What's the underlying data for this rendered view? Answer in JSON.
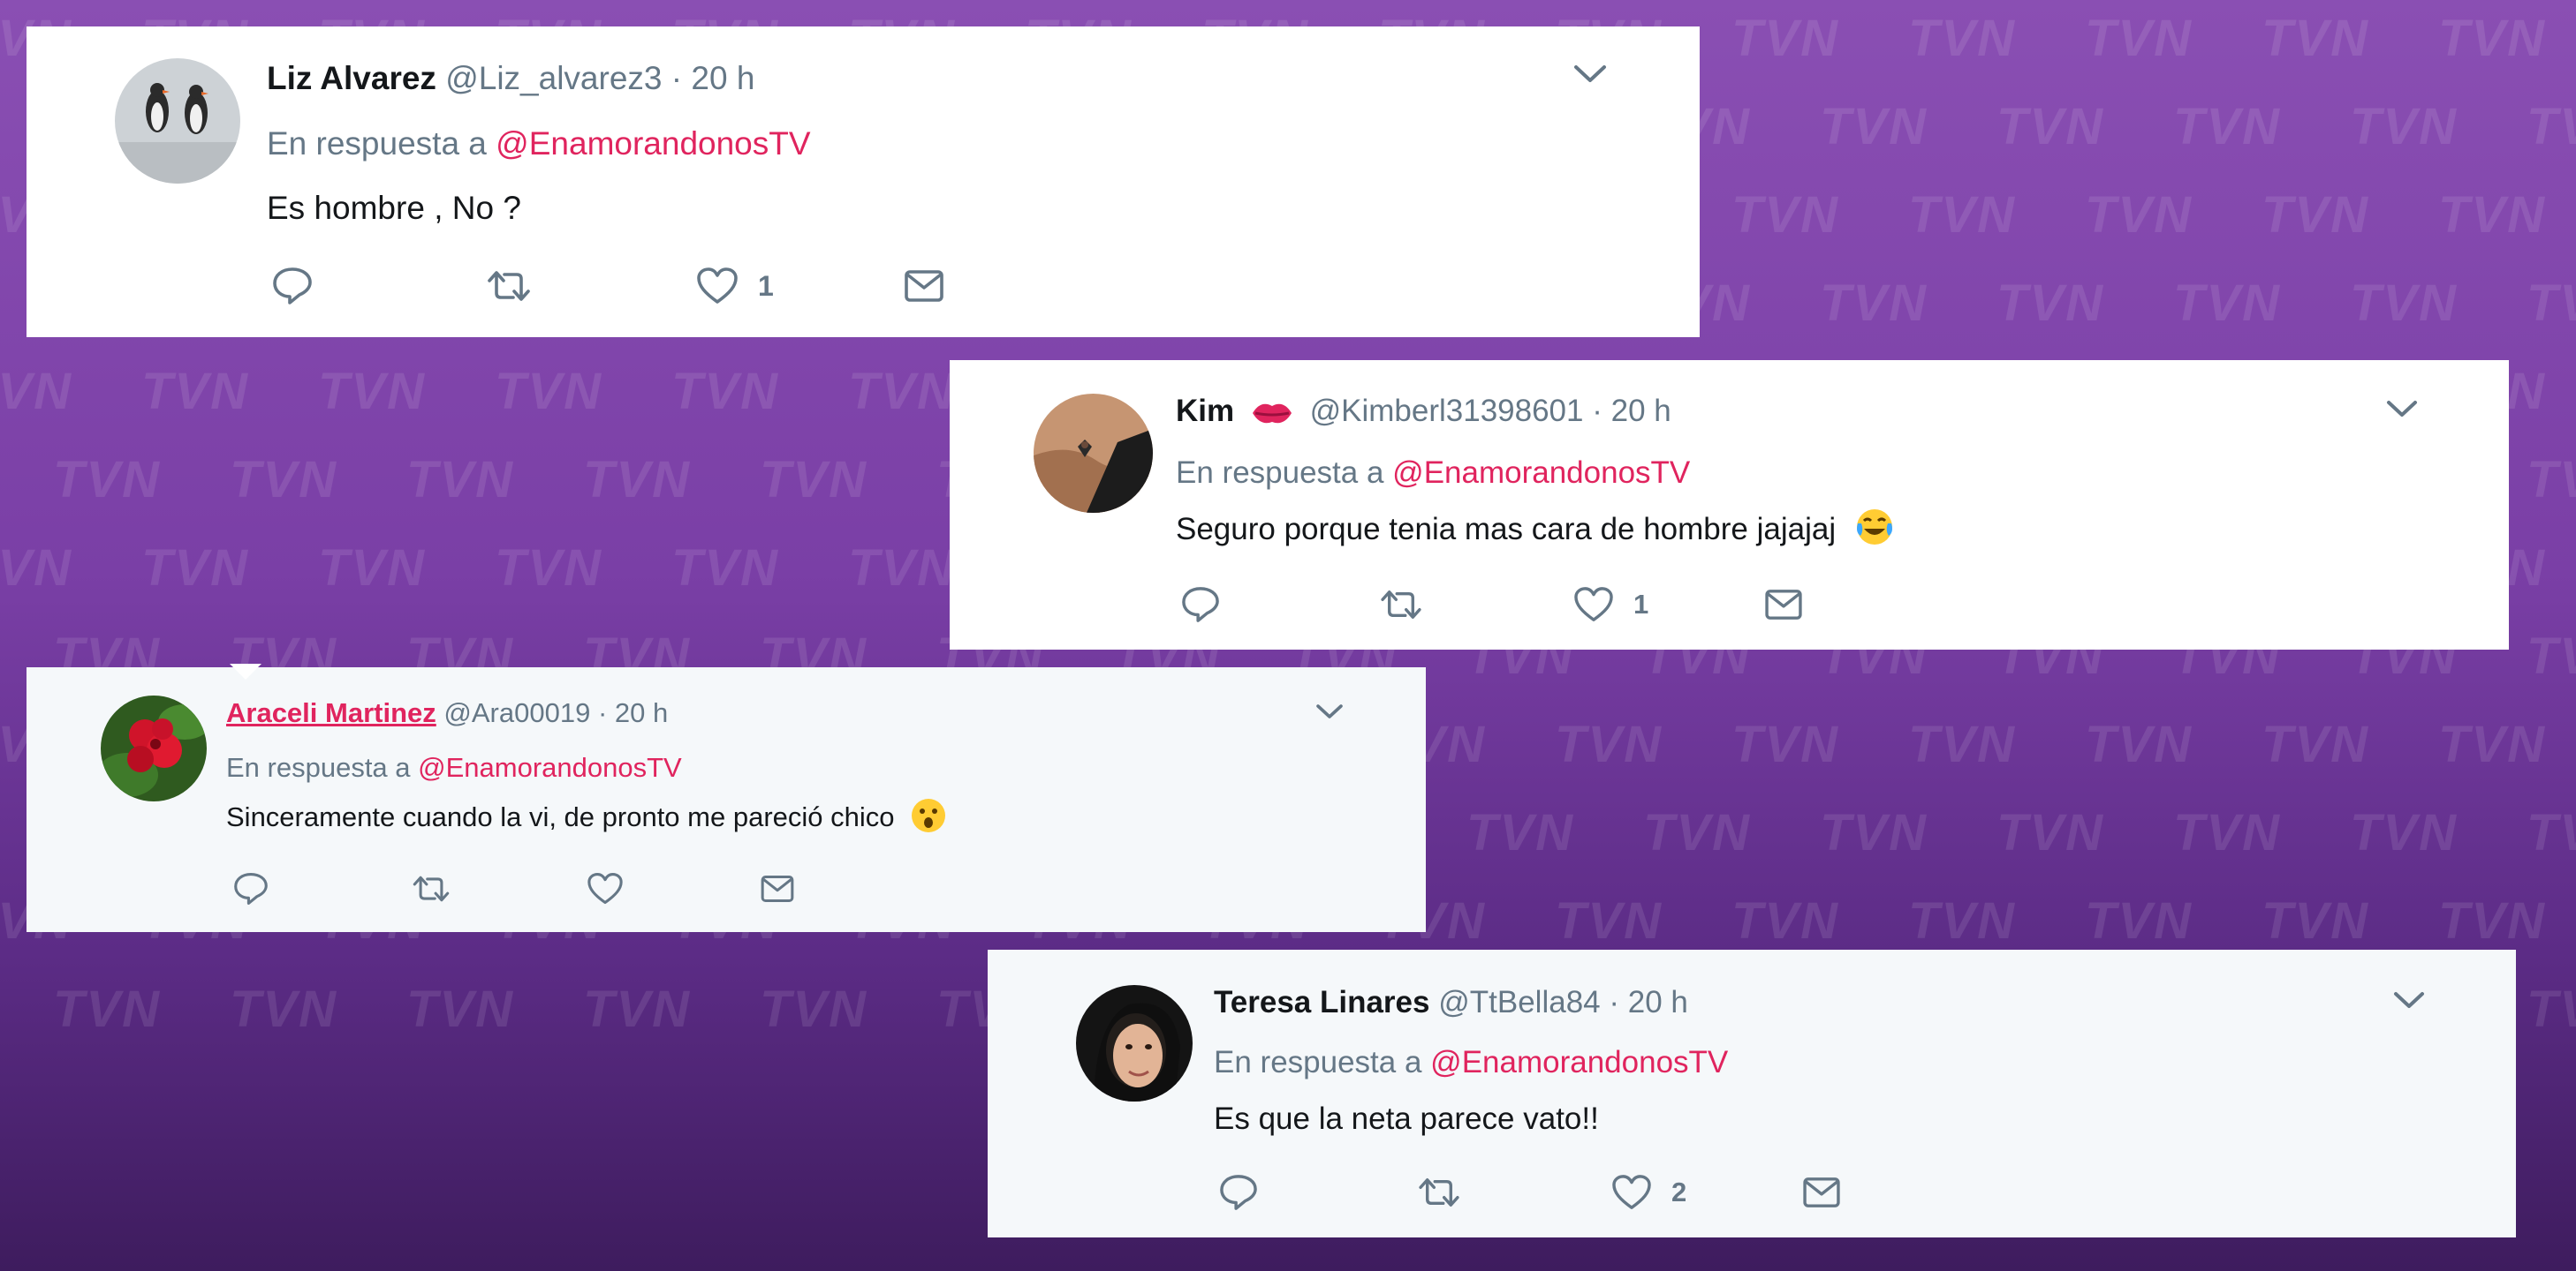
{
  "watermark_text": "TVN",
  "tweets": [
    {
      "name": "Liz Alvarez",
      "handle": "@Liz_alvarez3",
      "time": "· 20 h",
      "reply_prefix": "En respuesta a",
      "reply_to": "@EnamorandonosTV",
      "text": "Es hombre , No ?",
      "likes": "1"
    },
    {
      "name": "Kim",
      "name_emoji": "kiss-lips-emoji",
      "handle": "@Kimberl31398601",
      "time": "· 20 h",
      "reply_prefix": "En respuesta a",
      "reply_to": "@EnamorandonosTV",
      "text": "Seguro porque tenia mas cara de hombre jajajaj",
      "text_emoji": "tears-of-joy-emoji",
      "likes": "1"
    },
    {
      "name": "Araceli Martinez",
      "handle": "@Ara00019",
      "time": "· 20 h",
      "reply_prefix": "En respuesta a",
      "reply_to": "@EnamorandonosTV",
      "text": "Sinceramente cuando la vi, de pronto me pareció chico",
      "text_emoji": "astonished-face-emoji",
      "likes": ""
    },
    {
      "name": "Teresa Linares",
      "handle": "@TtBella84",
      "time": "· 20 h",
      "reply_prefix": "En respuesta a",
      "reply_to": "@EnamorandonosTV",
      "text": "Es que la neta parece vato!!",
      "likes": "2"
    }
  ],
  "colors": {
    "background": "#7a3fa6",
    "mention": "#e0245e",
    "text": "#14171a",
    "muted": "#657786"
  }
}
